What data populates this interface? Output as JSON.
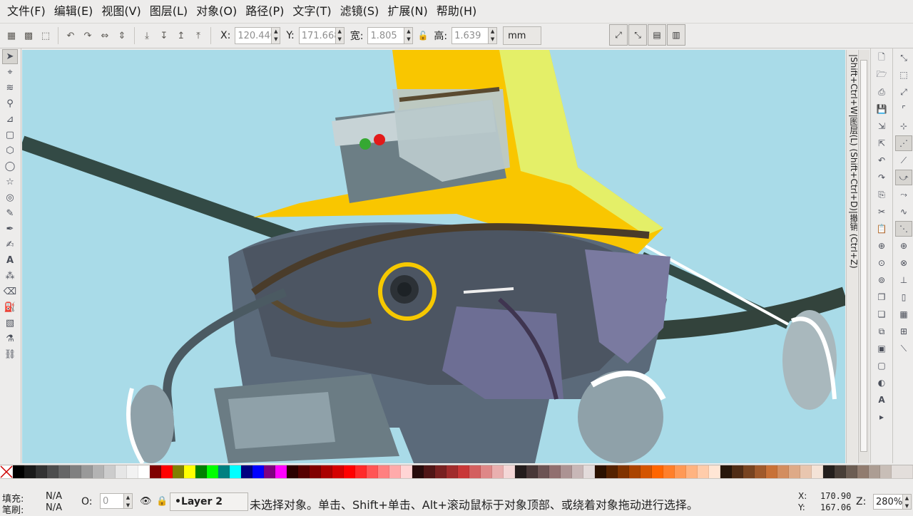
{
  "menu": [
    "文件(F)",
    "编辑(E)",
    "视图(V)",
    "图层(L)",
    "对象(O)",
    "路径(P)",
    "文字(T)",
    "滤镜(S)",
    "扩展(N)",
    "帮助(H)"
  ],
  "toolbar": {
    "x_label": "X:",
    "x_value": "120.440",
    "y_label": "Y:",
    "y_value": "171.668",
    "w_label": "宽:",
    "w_value": "1.805",
    "h_label": "高:",
    "h_value": "1.639",
    "unit": "mm"
  },
  "ruler_text": "|Shift+Ctrl+W|图层(L) (Shift+Ctrl+D)|撤销 (Ctrl+Z)",
  "palette_colors": [
    "#000000",
    "#1a1a1a",
    "#333333",
    "#4d4d4d",
    "#666666",
    "#808080",
    "#999999",
    "#b3b3b3",
    "#cccccc",
    "#e6e6e6",
    "#f2f2f2",
    "#ffffff",
    "#800000",
    "#ff0000",
    "#808000",
    "#ffff00",
    "#008000",
    "#00ff00",
    "#008080",
    "#00ffff",
    "#000080",
    "#0000ff",
    "#800080",
    "#ff00ff",
    "#2b0000",
    "#550000",
    "#800000",
    "#aa0000",
    "#d40000",
    "#ff0000",
    "#ff2a2a",
    "#ff5555",
    "#ff8080",
    "#ffaaaa",
    "#ffd5d5",
    "#280b0b",
    "#501616",
    "#782121",
    "#a02c2c",
    "#c83737",
    "#d35f5f",
    "#de8787",
    "#e9afaf",
    "#f4d7d7",
    "#241c1c",
    "#483737",
    "#6c5353",
    "#916f6f",
    "#ac9393",
    "#c8b7b7",
    "#e3dbdb",
    "#2b1100",
    "#552200",
    "#803300",
    "#aa4400",
    "#d45500",
    "#ff6600",
    "#ff7f2a",
    "#ff9955",
    "#ffb380",
    "#ffccaa",
    "#ffe6d5",
    "#28170b",
    "#502d16",
    "#784421",
    "#a05a2c",
    "#c87137",
    "#d38d5f",
    "#deaa87",
    "#e9c6af",
    "#f4e3d7",
    "#241f1c",
    "#483e37",
    "#6c5d53",
    "#917c6f",
    "#ac9d93",
    "#c8beb7",
    "#e3dedb"
  ],
  "status": {
    "fill_label": "填充:",
    "fill_value": "N/A",
    "stroke_label": "笔刷:",
    "stroke_value": "N/A",
    "opacity_label": "O:",
    "opacity_value": "0",
    "layer_name": "•Layer 2",
    "message": "未选择对象。单击、Shift+单击、Alt+滚动鼠标于对象顶部、或绕着对象拖动进行选择。",
    "cursor_x_label": "X:",
    "cursor_x": "170.90",
    "cursor_y_label": "Y:",
    "cursor_y": "167.06",
    "zoom_label": "Z:",
    "zoom_value": "280%"
  },
  "colors": {
    "canvas_bg": "#a9dbe8",
    "accent_yellow": "#f9c600"
  }
}
